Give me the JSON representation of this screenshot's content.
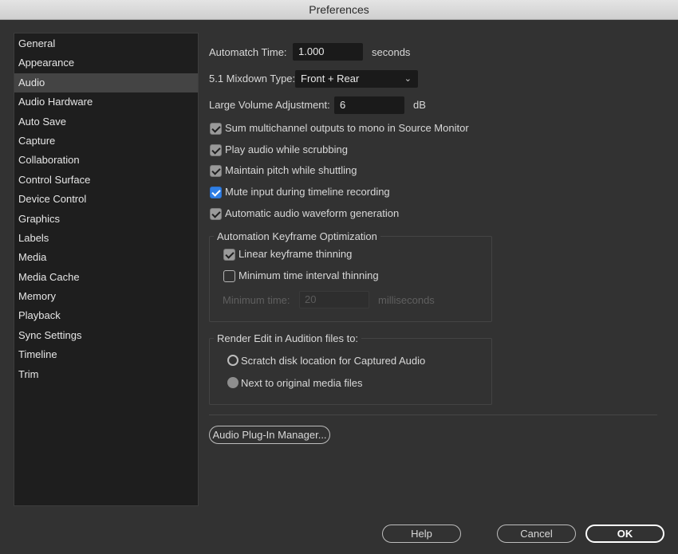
{
  "window": {
    "title": "Preferences"
  },
  "sidebar": {
    "items": [
      {
        "label": "General"
      },
      {
        "label": "Appearance"
      },
      {
        "label": "Audio",
        "selected": true
      },
      {
        "label": "Audio Hardware"
      },
      {
        "label": "Auto Save"
      },
      {
        "label": "Capture"
      },
      {
        "label": "Collaboration"
      },
      {
        "label": "Control Surface"
      },
      {
        "label": "Device Control"
      },
      {
        "label": "Graphics"
      },
      {
        "label": "Labels"
      },
      {
        "label": "Media"
      },
      {
        "label": "Media Cache"
      },
      {
        "label": "Memory"
      },
      {
        "label": "Playback"
      },
      {
        "label": "Sync Settings"
      },
      {
        "label": "Timeline"
      },
      {
        "label": "Trim"
      }
    ]
  },
  "audio": {
    "automatch": {
      "label": "Automatch Time:",
      "value": "1.000",
      "unit": "seconds"
    },
    "mixdown": {
      "label": "5.1 Mixdown Type:",
      "value": "Front + Rear"
    },
    "volume": {
      "label": "Large Volume Adjustment:",
      "value": "6",
      "unit": "dB"
    },
    "checkboxes": [
      {
        "label": "Sum multichannel outputs to mono in Source Monitor",
        "checked": true
      },
      {
        "label": "Play audio while scrubbing",
        "checked": true
      },
      {
        "label": "Maintain pitch while shuttling",
        "checked": true
      },
      {
        "label": "Mute input during timeline recording",
        "checked": true,
        "focused": true
      },
      {
        "label": "Automatic audio waveform generation",
        "checked": true
      }
    ],
    "keyframe_group": {
      "title": "Automation Keyframe Optimization",
      "linear": {
        "label": "Linear keyframe thinning",
        "checked": true
      },
      "minimum": {
        "label": "Minimum time interval thinning",
        "checked": false
      },
      "min_time": {
        "label": "Minimum time:",
        "value": "20",
        "unit": "milliseconds",
        "disabled": true
      }
    },
    "render_group": {
      "title": "Render Edit in Audition files to:",
      "options": [
        {
          "label": "Scratch disk location for Captured Audio",
          "selected": false
        },
        {
          "label": "Next to original media files",
          "selected": true
        }
      ]
    },
    "plugin_manager_label": "Audio Plug-In Manager..."
  },
  "footer": {
    "help": "Help",
    "cancel": "Cancel",
    "ok": "OK"
  }
}
